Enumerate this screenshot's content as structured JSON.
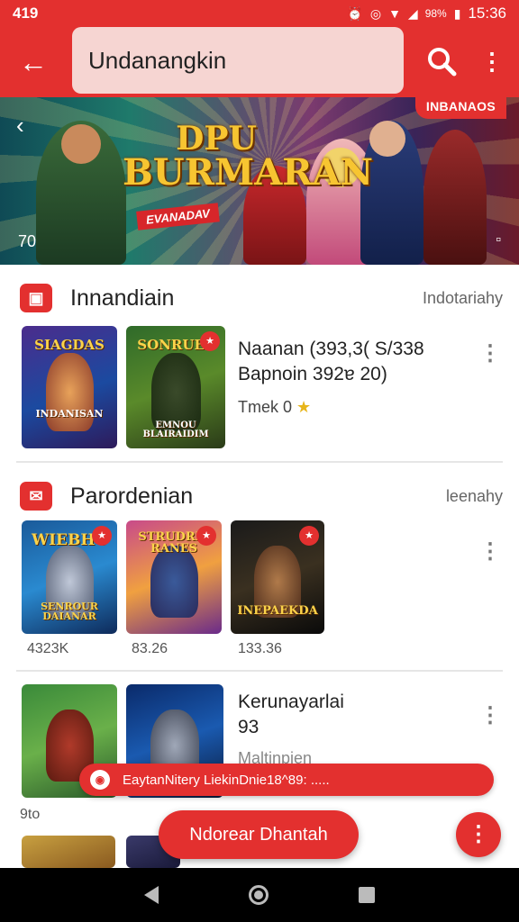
{
  "status_bar": {
    "time_left": "419",
    "battery_text": "98%",
    "time_right": "15:36"
  },
  "app_bar": {
    "search_value": "Undanangkin"
  },
  "banner": {
    "tag": "INBANAOS",
    "title_line1": "DPU",
    "title_line2": "BURMARAN",
    "subtitle": "EVANADAV",
    "counter": "70"
  },
  "sections": [
    {
      "title": "Innandiain",
      "more": "Indotariahy",
      "thumbs": [
        {
          "label": "SIAGDAS",
          "sub": "INDANISAN"
        },
        {
          "label": "SONRUES",
          "sub": "EMNOU BLAIRAIDIM"
        }
      ],
      "item": {
        "title": "Naanan (393,3( S/338",
        "subtitle": "Bapnoin 392ɐ 20)",
        "meta": "Tmek 0"
      }
    },
    {
      "title": "Parordenian",
      "more": "leenahy",
      "thumbs": [
        {
          "label": "WIEBHC",
          "sub": "SENROUR DAIANAR",
          "caption": "4323K"
        },
        {
          "label": "STRUDRIE RANES",
          "sub": "",
          "caption": "83.26"
        },
        {
          "label": "INEPAEKDA",
          "sub": "",
          "caption": "133.36"
        }
      ]
    },
    {
      "item": {
        "title": "Kerunayarlai",
        "subtitle": "93",
        "meta": "Maltinpien"
      }
    }
  ],
  "toast": {
    "text": "EaytanNitery LiekinDnie18^89: ....."
  },
  "bottom": {
    "caption": "9to",
    "cta_label": "Ndorear Dhantah"
  }
}
